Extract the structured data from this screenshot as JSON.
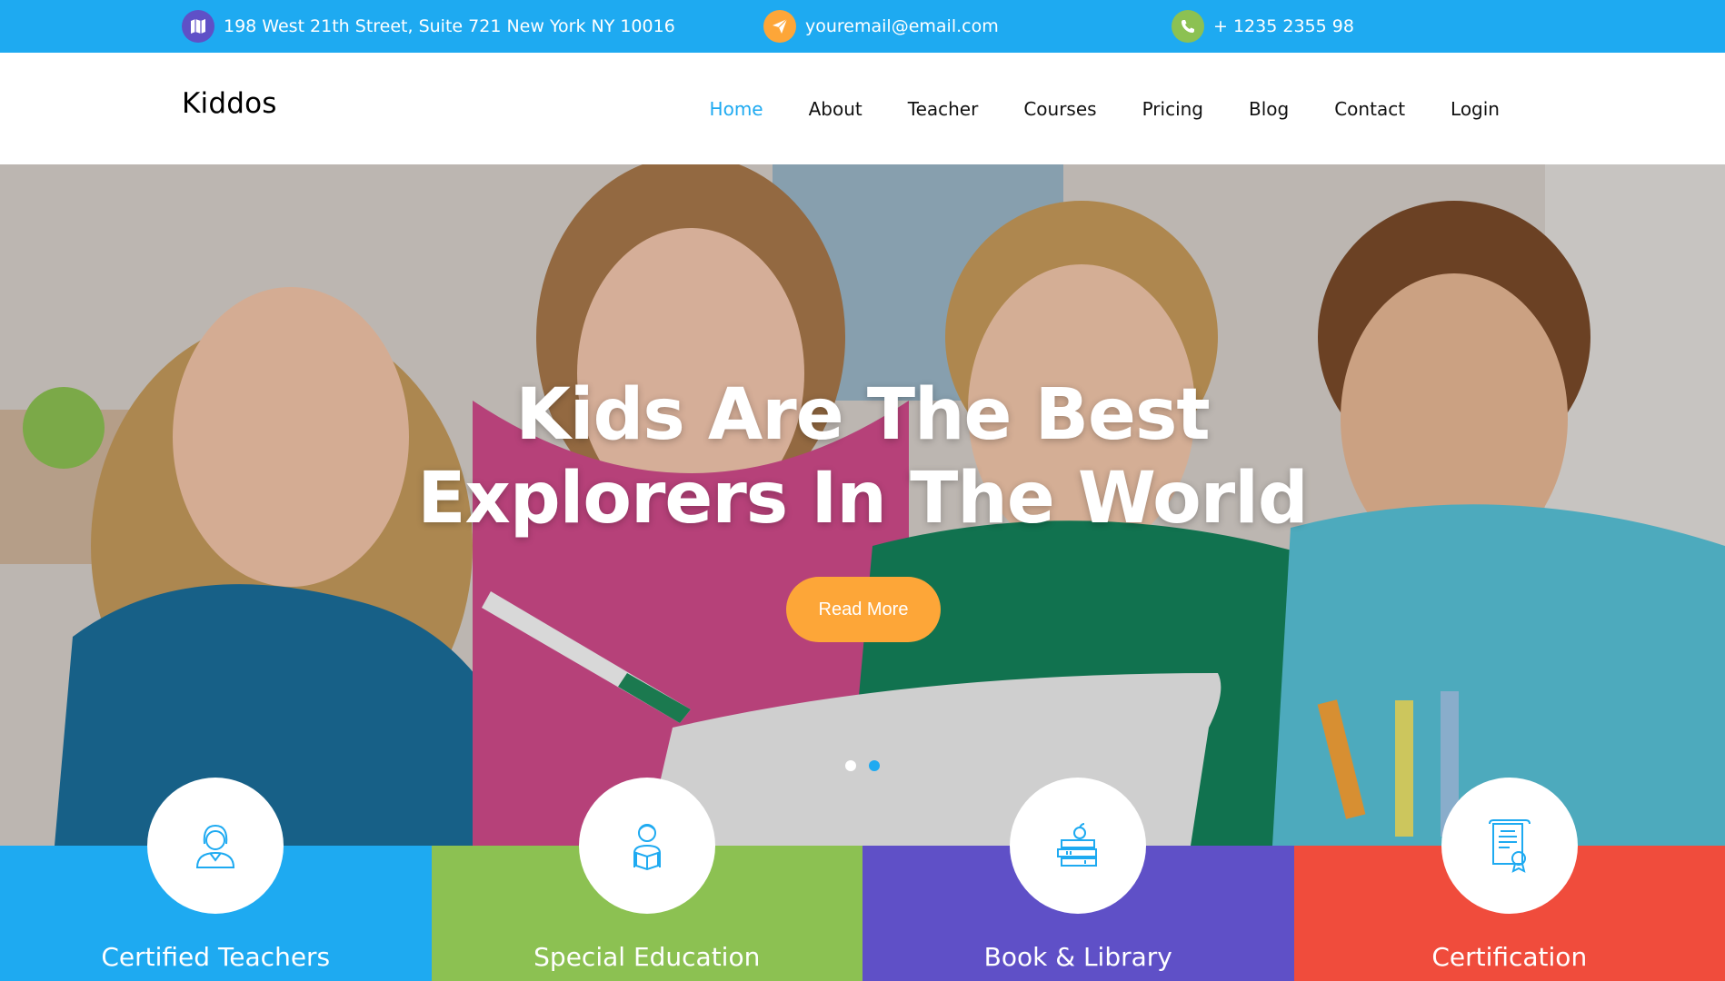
{
  "topbar": {
    "address": "198 West 21th Street, Suite 721 New York NY 10016",
    "email": "youremail@email.com",
    "phone": "+ 1235 2355 98",
    "icons": [
      "map-icon",
      "paper-plane-icon",
      "phone-icon"
    ]
  },
  "brand": {
    "name": "Kiddos"
  },
  "nav": {
    "items": [
      {
        "label": "Home",
        "active": true
      },
      {
        "label": "About"
      },
      {
        "label": "Teacher"
      },
      {
        "label": "Courses"
      },
      {
        "label": "Pricing"
      },
      {
        "label": "Blog"
      },
      {
        "label": "Contact"
      },
      {
        "label": "Login"
      }
    ]
  },
  "hero": {
    "title_line1": "Kids Are The Best",
    "title_line2": "Explorers In The World",
    "button_label": "Read More",
    "slides": 2,
    "active_slide": 2
  },
  "features": [
    {
      "label": "Certified Teachers",
      "icon": "teacher-icon",
      "color": "#1eaaf1"
    },
    {
      "label": "Special Education",
      "icon": "student-reading-icon",
      "color": "#8cc152"
    },
    {
      "label": "Book & Library",
      "icon": "books-apple-icon",
      "color": "#5f50c7"
    },
    {
      "label": "Certification",
      "icon": "certificate-icon",
      "color": "#f04c3c"
    }
  ],
  "colors": {
    "primary": "#1eaaf1",
    "accent": "#fda638",
    "green": "#8cc152",
    "purple": "#5f50c7",
    "red": "#f04c3c"
  }
}
